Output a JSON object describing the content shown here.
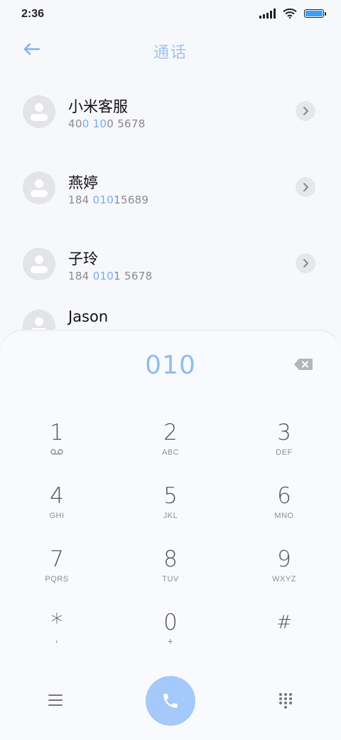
{
  "status": {
    "time": "2:36"
  },
  "header": {
    "title": "通话"
  },
  "contacts": [
    {
      "name": "小米客服",
      "number_parts": [
        "40",
        "0",
        " ",
        "10",
        "0 5678"
      ]
    },
    {
      "name": "燕婷",
      "number_parts": [
        "184 ",
        "010",
        "15689",
        "",
        ""
      ]
    },
    {
      "name": "子玲",
      "number_parts": [
        "184 ",
        "010",
        "1 5678",
        "",
        ""
      ]
    },
    {
      "name": "Jason"
    }
  ],
  "dialer": {
    "input": "010",
    "keys": [
      {
        "num": "1",
        "sub": ""
      },
      {
        "num": "2",
        "sub": "ABC"
      },
      {
        "num": "3",
        "sub": "DEF"
      },
      {
        "num": "4",
        "sub": "GHI"
      },
      {
        "num": "5",
        "sub": "JKL"
      },
      {
        "num": "6",
        "sub": "MNO"
      },
      {
        "num": "7",
        "sub": "PQRS"
      },
      {
        "num": "8",
        "sub": "TUV"
      },
      {
        "num": "9",
        "sub": "WXYZ"
      },
      {
        "num": "*",
        "sub": ","
      },
      {
        "num": "0",
        "sub": "+"
      },
      {
        "num": "#",
        "sub": ""
      }
    ]
  },
  "colors": {
    "accent": "#8fbcf3",
    "call_button": "#a4c9fa"
  },
  "icons": {
    "back": "arrow-left-icon",
    "delete": "backspace-icon",
    "voicemail": "voicemail-icon",
    "menu": "menu-icon",
    "call": "phone-icon",
    "keypad": "dialpad-icon"
  }
}
